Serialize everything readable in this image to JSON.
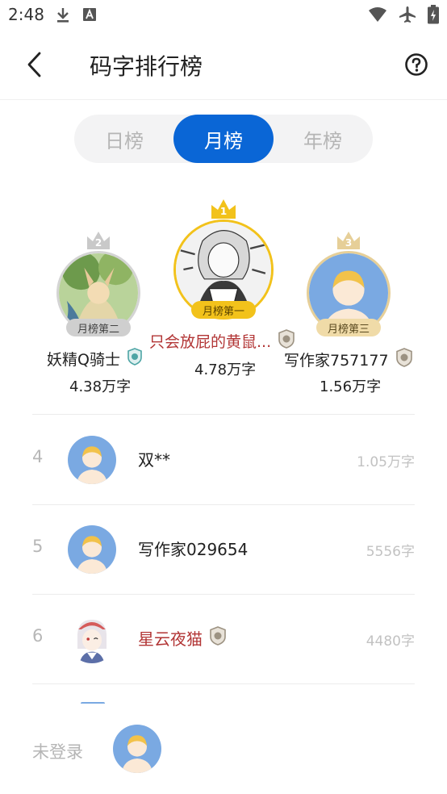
{
  "status": {
    "time": "2:48",
    "icons_left": [
      "download-icon",
      "font-icon"
    ],
    "icons_right": [
      "wifi-icon",
      "airplane-mode-icon",
      "battery-charging-icon"
    ]
  },
  "header": {
    "title": "码字排行榜",
    "back_icon": "chevron-left-icon",
    "help_icon": "help-circle-icon"
  },
  "tabs": [
    {
      "label": "日榜",
      "active": false
    },
    {
      "label": "月榜",
      "active": true
    },
    {
      "label": "年榜",
      "active": false
    }
  ],
  "podium": {
    "first": {
      "rank": "1",
      "badge": "月榜第一",
      "name": "只会放屁的黄鼠...",
      "count": "4.78万字"
    },
    "second": {
      "rank": "2",
      "badge": "月榜第二",
      "name": "妖精Q骑士",
      "count": "4.38万字"
    },
    "third": {
      "rank": "3",
      "badge": "月榜第三",
      "name": "写作家757177",
      "count": "1.56万字"
    }
  },
  "list": [
    {
      "rank": "4",
      "name": "双**",
      "count": "1.05万字"
    },
    {
      "rank": "5",
      "name": "写作家029654",
      "count": "5556字"
    },
    {
      "rank": "6",
      "name": "星云夜猫",
      "count": "4480字"
    }
  ],
  "footer": {
    "login_text": "未登录"
  },
  "colors": {
    "accent": "#0a66d6",
    "gold": "#f2c21b",
    "silver": "#c8c8c8",
    "bronze": "#e6cf98",
    "vip_name": "#b23535",
    "avatar_bg": "#7aa9e2"
  }
}
